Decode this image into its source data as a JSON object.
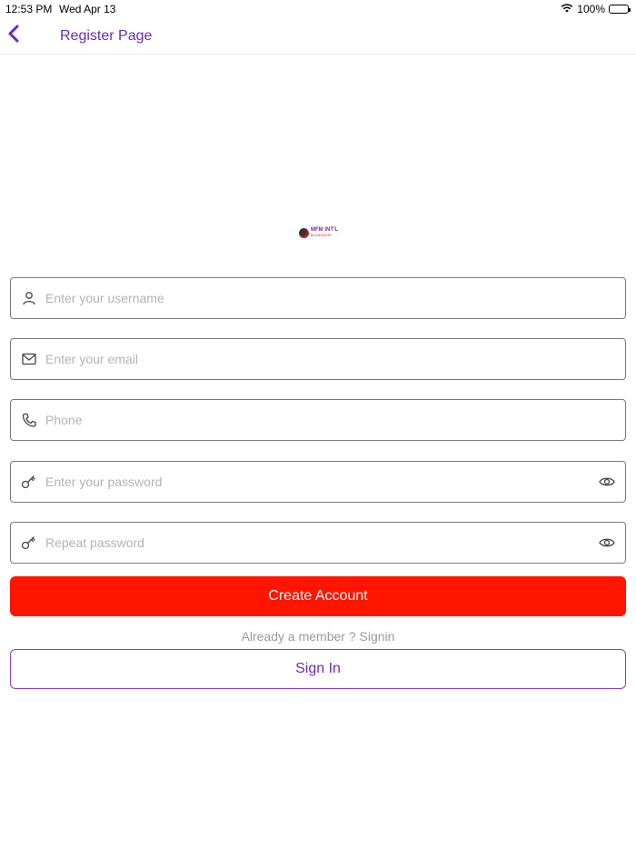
{
  "status_bar": {
    "time": "12:53 PM",
    "date": "Wed Apr 13",
    "battery": "100%"
  },
  "nav": {
    "title": "Register Page",
    "back_icon": "chevron-left-icon"
  },
  "logo": {
    "line1": "MFM INT'L",
    "line2": "BOOKSHOP"
  },
  "form": {
    "username": {
      "placeholder": "Enter your username",
      "icon": "user-icon"
    },
    "email": {
      "placeholder": "Enter your email",
      "icon": "mail-icon"
    },
    "phone": {
      "placeholder": "Phone",
      "icon": "phone-icon"
    },
    "password": {
      "placeholder": "Enter your password",
      "icon": "key-icon",
      "toggle_icon": "eye-icon"
    },
    "repeat_password": {
      "placeholder": "Repeat password",
      "icon": "key-icon",
      "toggle_icon": "eye-icon"
    }
  },
  "actions": {
    "create_account_label": "Create Account",
    "member_text": "Already a member ? Signin",
    "sign_in_label": "Sign In"
  },
  "colors": {
    "accent": "#6b2bb5",
    "primary_button": "#ff1500"
  }
}
